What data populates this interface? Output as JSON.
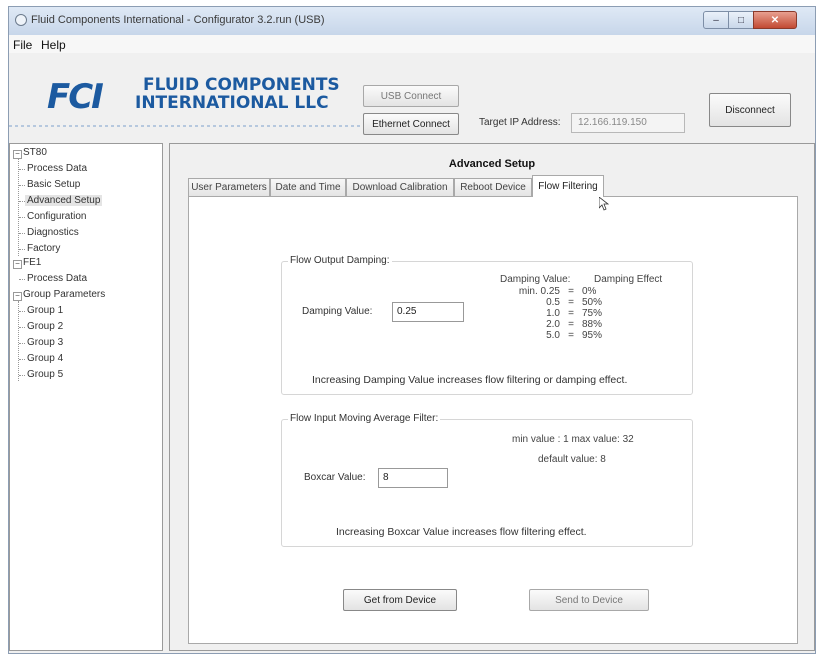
{
  "window": {
    "title": "Fluid Components International - Configurator 3.2.run (USB)",
    "controls": {
      "minimize": "–",
      "maximize": "□",
      "close": "✕"
    }
  },
  "menu": {
    "file": "File",
    "help": "Help"
  },
  "brand": {
    "logo_mark": "FCI",
    "line1": "FLUID COMPONENTS",
    "line2": "INTERNATIONAL LLC",
    "color": "#1c5aa0"
  },
  "connect": {
    "usb_label": "USB Connect",
    "ethernet_label": "Ethernet Connect",
    "target_ip_label": "Target IP Address:",
    "target_ip_value": "12.166.119.150",
    "disconnect_label": "Disconnect"
  },
  "tree": {
    "st80": "ST80",
    "st80_children": [
      "Process Data",
      "Basic Setup",
      "Advanced Setup",
      "Configuration",
      "Diagnostics",
      "Factory"
    ],
    "fe1": "FE1",
    "fe1_children": [
      "Process Data"
    ],
    "group_params": "Group Parameters",
    "groups": [
      "Group 1",
      "Group 2",
      "Group 3",
      "Group 4",
      "Group 5"
    ],
    "selected": "Advanced Setup"
  },
  "panel": {
    "title": "Advanced Setup",
    "tabs": [
      "User Parameters",
      "Date and Time",
      "Download Calibration",
      "Reboot Device",
      "Flow Filtering"
    ],
    "active_tab": "Flow Filtering"
  },
  "damping": {
    "legend": "Flow Output Damping:",
    "label": "Damping Value:",
    "value": "0.25",
    "col1_header": "Damping Value:",
    "col2_header": "Damping Effect",
    "rows": [
      {
        "value": "min. 0.25",
        "eq": "=",
        "effect": "0%"
      },
      {
        "value": "0.5",
        "eq": "=",
        "effect": "50%"
      },
      {
        "value": "1.0",
        "eq": "=",
        "effect": "75%"
      },
      {
        "value": "2.0",
        "eq": "=",
        "effect": "88%"
      },
      {
        "value": "5.0",
        "eq": "=",
        "effect": "95%"
      }
    ],
    "note": "Increasing Damping Value increases flow filtering or damping effect."
  },
  "boxcar": {
    "legend": "Flow Input Moving Average Filter:",
    "label": "Boxcar Value:",
    "value": "8",
    "range": "min value : 1  max value: 32",
    "default": "default value: 8",
    "note": "Increasing Boxcar Value increases flow filtering effect."
  },
  "actions": {
    "get": "Get from Device",
    "send": "Send to Device"
  }
}
